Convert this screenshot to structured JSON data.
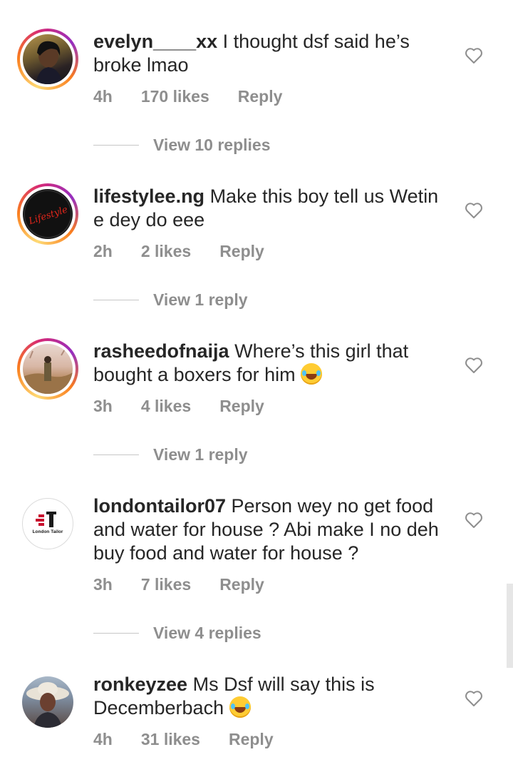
{
  "comments": [
    {
      "username": "evelyn____xx",
      "text": " I thought dsf said he’s broke lmao",
      "time": "4h",
      "likes": "170 likes",
      "reply": "Reply",
      "view_replies": "View 10 replies",
      "avatar": "profile-photo-woman"
    },
    {
      "username": "lifestylee.ng",
      "text": " Make this boy tell us Wetin e dey do eee",
      "time": "2h",
      "likes": "2 likes",
      "reply": "Reply",
      "view_replies": "View 1 reply",
      "avatar": "lifestyle-logo",
      "avatar_text": "Lifestyle"
    },
    {
      "username": "rasheedofnaija",
      "text": " Where’s this girl that bought a boxers for him",
      "emoji": "face-with-tears-of-joy",
      "time": "3h",
      "likes": "4 likes",
      "reply": "Reply",
      "view_replies": "View 1 reply",
      "avatar": "profile-photo-outdoor"
    },
    {
      "username": "londontailor07",
      "text": " Person wey no get food and water for house ? Abi make I no deh buy food and water for house ?",
      "time": "3h",
      "likes": "7 likes",
      "reply": "Reply",
      "view_replies": "View 4 replies",
      "avatar": "london-tailor-logo",
      "avatar_text": "London Tailor"
    },
    {
      "username": "ronkeyzee",
      "text": " Ms Dsf will say this is Decemberbach",
      "emoji": "face-with-tears-of-joy",
      "time": "4h",
      "likes": "31 likes",
      "reply": "Reply",
      "avatar": "profile-photo-hat"
    }
  ],
  "colors": {
    "text": "#262626",
    "muted": "#8e8e8e",
    "story_ring": [
      "#feda75",
      "#fa7e1e",
      "#d62976",
      "#962fbf"
    ]
  }
}
